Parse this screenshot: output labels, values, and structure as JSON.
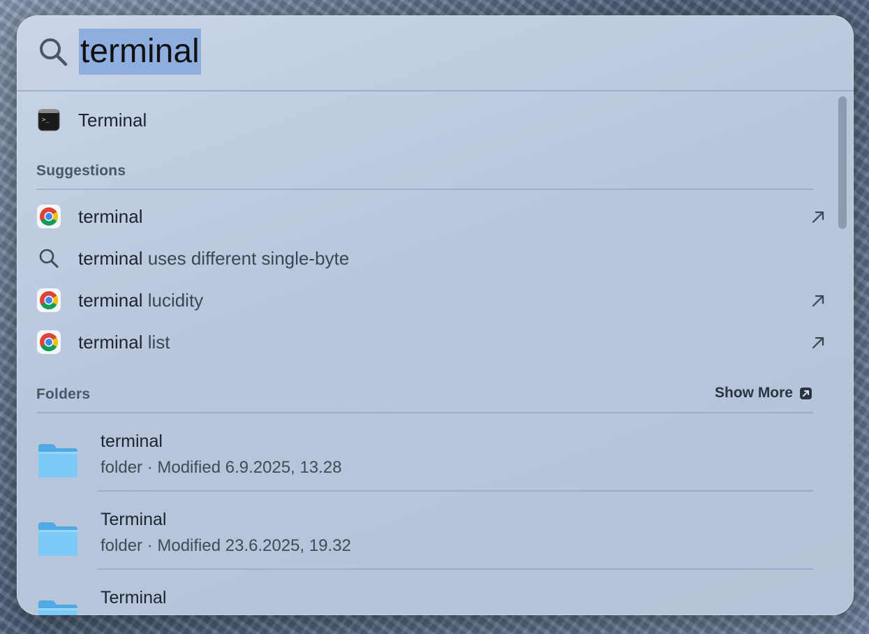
{
  "search": {
    "query": "terminal"
  },
  "top_hit": {
    "label": "Terminal",
    "icon": "terminal-app-icon"
  },
  "suggestions": {
    "header": "Suggestions",
    "items": [
      {
        "match": "terminal",
        "rest": "",
        "icon": "chrome-icon",
        "has_arrow": true
      },
      {
        "match": "terminal",
        "rest": " uses different single-byte",
        "icon": "search-icon",
        "has_arrow": false
      },
      {
        "match": "terminal",
        "rest": " lucidity",
        "icon": "chrome-icon",
        "has_arrow": true
      },
      {
        "match": "terminal",
        "rest": " list",
        "icon": "chrome-icon",
        "has_arrow": true
      }
    ]
  },
  "folders": {
    "header": "Folders",
    "show_more_label": "Show More",
    "items": [
      {
        "name": "terminal",
        "meta": "folder · Modified 6.9.2025, 13.28"
      },
      {
        "name": "Terminal",
        "meta": "folder · Modified 23.6.2025, 19.32"
      },
      {
        "name": "Terminal",
        "meta": ""
      }
    ]
  },
  "colors": {
    "selection": "#8eaee0",
    "folder": "#6cc0f0",
    "panel": "#bfcbe0"
  }
}
